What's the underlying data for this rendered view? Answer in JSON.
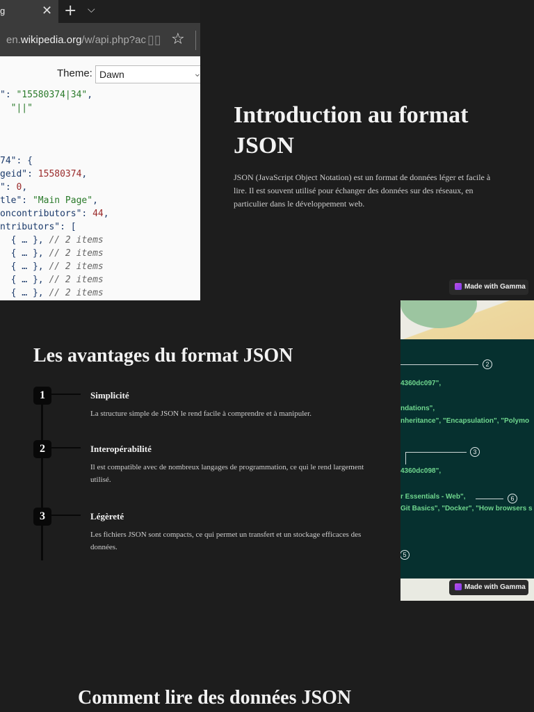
{
  "browser": {
    "tab_title": "g",
    "url_domain_prefix": "en.",
    "url_domain": "wikipedia.org",
    "url_path": "/w/api.php?ac",
    "theme_label": "Theme:",
    "theme_value": "Dawn",
    "code_lines": [
      [
        {
          "t": "\": ",
          "k": "p"
        },
        {
          "t": "\"15580374|34\"",
          "k": "s"
        },
        {
          "t": ",",
          "k": "p"
        }
      ],
      [
        {
          "t": "  ",
          "k": "p"
        },
        {
          "t": "\"||\"",
          "k": "s"
        }
      ],
      [],
      [],
      [],
      [
        {
          "t": "74\": {",
          "k": "p"
        }
      ],
      [
        {
          "t": "geid\": ",
          "k": "p"
        },
        {
          "t": "15580374",
          "k": "n"
        },
        {
          "t": ",",
          "k": "p"
        }
      ],
      [
        {
          "t": "\": ",
          "k": "p"
        },
        {
          "t": "0",
          "k": "n"
        },
        {
          "t": ",",
          "k": "p"
        }
      ],
      [
        {
          "t": "tle\": ",
          "k": "p"
        },
        {
          "t": "\"Main Page\"",
          "k": "s"
        },
        {
          "t": ",",
          "k": "p"
        }
      ],
      [
        {
          "t": "oncontributors\": ",
          "k": "p"
        },
        {
          "t": "44",
          "k": "n"
        },
        {
          "t": ",",
          "k": "p"
        }
      ],
      [
        {
          "t": "ntributors\": [",
          "k": "p"
        }
      ],
      [
        {
          "t": "  { … }, ",
          "k": "p"
        },
        {
          "t": "// 2 items",
          "k": "c"
        }
      ],
      [
        {
          "t": "  { … }, ",
          "k": "p"
        },
        {
          "t": "// 2 items",
          "k": "c"
        }
      ],
      [
        {
          "t": "  { … }, ",
          "k": "p"
        },
        {
          "t": "// 2 items",
          "k": "c"
        }
      ],
      [
        {
          "t": "  { … }, ",
          "k": "p"
        },
        {
          "t": "// 2 items",
          "k": "c"
        }
      ],
      [
        {
          "t": "  { … }, ",
          "k": "p"
        },
        {
          "t": "// 2 items",
          "k": "c"
        }
      ]
    ]
  },
  "intro": {
    "title": "Introduction au format JSON",
    "body": "JSON (JavaScript Object Notation) est un format de données léger et facile à lire. Il est souvent utilisé pour échanger des données sur des réseaux, en particulier dans le développement web."
  },
  "badge": "Made with Gamma",
  "advantages": {
    "title": "Les avantages du format JSON",
    "items": [
      {
        "num": "1",
        "title": "Simplicité",
        "body": "La structure simple de JSON le rend facile à comprendre et à manipuler."
      },
      {
        "num": "2",
        "title": "Interopérabilité",
        "body": "Il est compatible avec de nombreux langages de programmation, ce qui le rend largement utilisé."
      },
      {
        "num": "3",
        "title": "Légèreté",
        "body": "Les fichiers JSON sont compacts, ce qui permet un transfert et un stockage efficaces des données."
      }
    ]
  },
  "diagram": {
    "lines": [
      "4360dc097\",",
      "ndations\",",
      "nheritance\", \"Encapsulation\", \"Polymo",
      "4360dc098\",",
      "r Essentials - Web\",",
      "Git Basics\", \"Docker\", \"How browsers s"
    ],
    "markers": [
      "2",
      "3",
      "6",
      "5"
    ]
  },
  "section3": {
    "title": "Comment lire des données JSON"
  },
  "colors": {
    "background": "#1d1d1d",
    "diagram_bg": "#06302f",
    "code_green": "#6fd68e"
  }
}
